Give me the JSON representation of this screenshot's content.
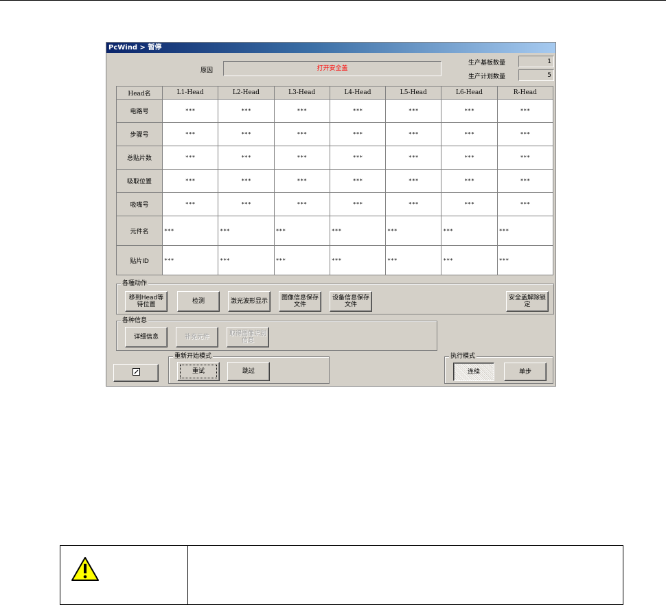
{
  "window": {
    "title": "PcWind > 暂停"
  },
  "reason": {
    "label": "原因",
    "value": "打开安全盖"
  },
  "counters": {
    "produced_label": "生产基板数量",
    "produced_value": "1",
    "planned_label": "生产计划数量",
    "planned_value": "5"
  },
  "grid": {
    "corner": "Head名",
    "columns": [
      "L1-Head",
      "L2-Head",
      "L3-Head",
      "L4-Head",
      "L5-Head",
      "L6-Head",
      "R-Head"
    ],
    "rows": [
      {
        "label": "电路号",
        "cells": [
          "***",
          "***",
          "***",
          "***",
          "***",
          "***",
          "***"
        ]
      },
      {
        "label": "步骤号",
        "cells": [
          "***",
          "***",
          "***",
          "***",
          "***",
          "***",
          "***"
        ]
      },
      {
        "label": "总贴片数",
        "cells": [
          "***",
          "***",
          "***",
          "***",
          "***",
          "***",
          "***"
        ]
      },
      {
        "label": "吸取位置",
        "cells": [
          "***",
          "***",
          "***",
          "***",
          "***",
          "***",
          "***"
        ]
      },
      {
        "label": "吸嘴号",
        "cells": [
          "***",
          "***",
          "***",
          "***",
          "***",
          "***",
          "***"
        ]
      },
      {
        "label": "元件名",
        "cells": [
          "***",
          "***",
          "***",
          "***",
          "***",
          "***",
          "***"
        ]
      },
      {
        "label": "贴片ID",
        "cells": [
          "***",
          "***",
          "***",
          "***",
          "***",
          "***",
          "***"
        ]
      }
    ]
  },
  "actions": {
    "title": "各種动作",
    "move_head": "移到Head等待位置",
    "detect": "检测",
    "laser_wave": "激光波形显示",
    "image_save": "图像信息保存文件",
    "device_save": "设备信息保存文件",
    "unlock_cover": "安全盖解除锁定"
  },
  "info": {
    "title": "各种信息",
    "detail": "详细信息",
    "supplement": "补充元件",
    "image_error": "取得图像识别信息"
  },
  "restart": {
    "title": "重新开始模式",
    "retry": "重试",
    "skip": "跳过"
  },
  "exec_mode": {
    "title": "执行模式",
    "continuous": "连续",
    "step": "单步"
  },
  "small_button": {
    "icon": "edit-icon"
  }
}
